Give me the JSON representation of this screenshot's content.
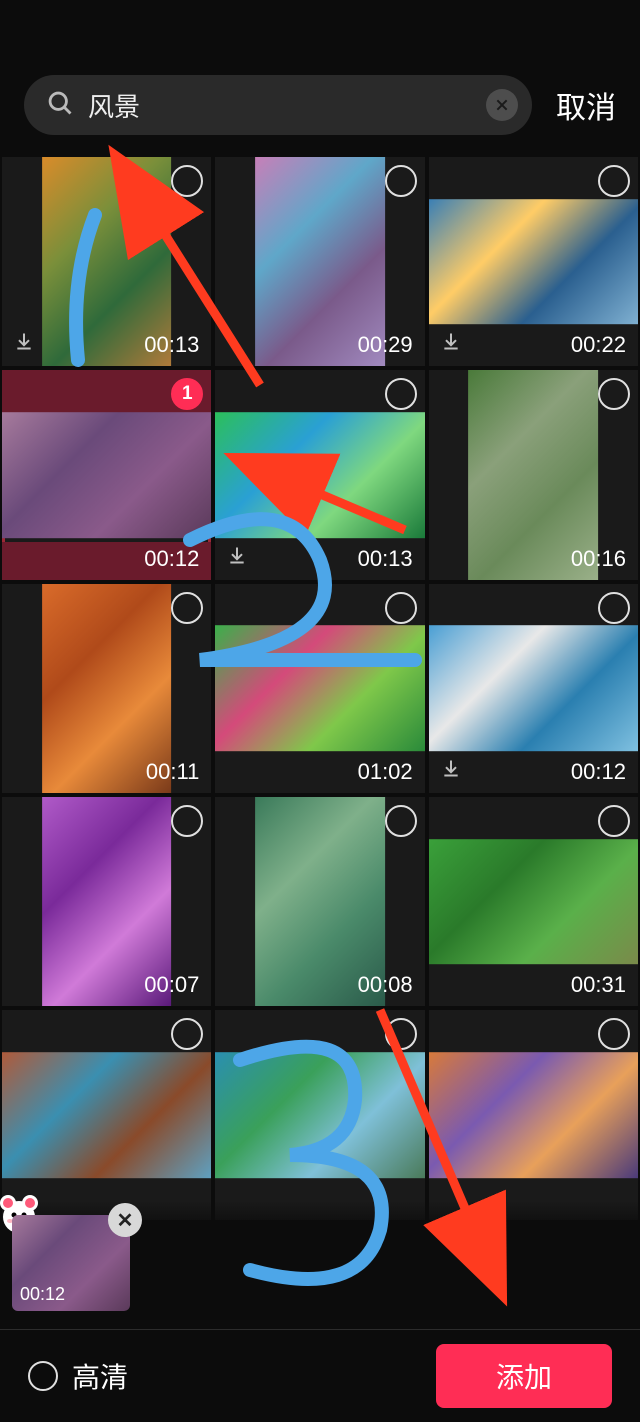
{
  "search": {
    "query": "风景",
    "cancel_label": "取消"
  },
  "grid": [
    {
      "duration": "00:13",
      "orient": "portrait",
      "scene": "autumn-park-path",
      "selected": false,
      "sel_badge": "",
      "show_dl": true,
      "colors": [
        "#d98b2a",
        "#7a8f3a",
        "#2f6a3a",
        "#b07a3a"
      ]
    },
    {
      "duration": "00:29",
      "orient": "portrait",
      "scene": "cherry-blossom-dock",
      "selected": false,
      "sel_badge": "",
      "show_dl": false,
      "colors": [
        "#c77fb8",
        "#5fa7c9",
        "#7a5a8a",
        "#a18abf"
      ]
    },
    {
      "duration": "00:22",
      "orient": "land",
      "scene": "sunset-sea-birds",
      "selected": false,
      "sel_badge": "",
      "show_dl": true,
      "colors": [
        "#3a7fb5",
        "#ffcc66",
        "#2a5f8f",
        "#7fb0d1"
      ]
    },
    {
      "duration": "00:12",
      "orient": "land",
      "scene": "girl-back-sea",
      "selected": true,
      "sel_badge": "1",
      "show_dl": false,
      "colors": [
        "#a67a9c",
        "#6a4a7a",
        "#8a5a8a",
        "#5a3a5a"
      ]
    },
    {
      "duration": "00:13",
      "orient": "land",
      "scene": "green-field-sky",
      "selected": false,
      "sel_badge": "",
      "show_dl": true,
      "colors": [
        "#2bbf5b",
        "#2aa0d4",
        "#7fd87f",
        "#1a7a3a"
      ]
    },
    {
      "duration": "00:16",
      "orient": "portrait",
      "scene": "boardwalk-trees",
      "selected": false,
      "sel_badge": "",
      "show_dl": false,
      "colors": [
        "#4a7a3a",
        "#8aa07a",
        "#6a8a5a",
        "#9ab089"
      ]
    },
    {
      "duration": "00:11",
      "orient": "portrait",
      "scene": "autumn-boardwalk",
      "selected": false,
      "sel_badge": "",
      "show_dl": false,
      "colors": [
        "#d96b2a",
        "#b04a1a",
        "#e88a3a",
        "#7a3a1a"
      ]
    },
    {
      "duration": "01:02",
      "orient": "land",
      "scene": "flower-meadow",
      "selected": false,
      "sel_badge": "",
      "show_dl": false,
      "colors": [
        "#3ab04a",
        "#d44a7a",
        "#7fc84a",
        "#2a8a3a"
      ]
    },
    {
      "duration": "00:12",
      "orient": "land",
      "scene": "bride-seaside",
      "selected": false,
      "sel_badge": "",
      "show_dl": true,
      "colors": [
        "#4a9fd4",
        "#e8e8e8",
        "#2a7fb0",
        "#7fc0e0"
      ]
    },
    {
      "duration": "00:07",
      "orient": "portrait",
      "scene": "purple-lavender-trees",
      "selected": false,
      "sel_badge": "",
      "show_dl": false,
      "colors": [
        "#b05ac8",
        "#7a2a9a",
        "#d07ad8",
        "#5a1a7a"
      ]
    },
    {
      "duration": "00:08",
      "orient": "portrait",
      "scene": "mountain-lake-lotus",
      "selected": false,
      "sel_badge": "",
      "show_dl": false,
      "colors": [
        "#3a7a5a",
        "#7fb08a",
        "#4a8a6a",
        "#2a5a4a"
      ]
    },
    {
      "duration": "00:31",
      "orient": "land",
      "scene": "rice-terrace-village",
      "selected": false,
      "sel_badge": "",
      "show_dl": false,
      "colors": [
        "#3aa03a",
        "#2a7a2a",
        "#5ab04a",
        "#7a8a4a"
      ]
    },
    {
      "duration": "",
      "orient": "land",
      "scene": "red-rock-canyon",
      "selected": false,
      "sel_badge": "",
      "show_dl": false,
      "colors": [
        "#b05a3a",
        "#3a8fb0",
        "#8a4a2a",
        "#5fa0c0"
      ]
    },
    {
      "duration": "",
      "orient": "land",
      "scene": "tropical-beach-palms",
      "selected": false,
      "sel_badge": "",
      "show_dl": false,
      "colors": [
        "#2a8fb0",
        "#3aa05a",
        "#7fc0d8",
        "#4a7a5a"
      ]
    },
    {
      "duration": "",
      "orient": "land",
      "scene": "sunset-path-clouds",
      "selected": false,
      "sel_badge": "",
      "show_dl": false,
      "colors": [
        "#d87a3a",
        "#7a5ab0",
        "#e8a05a",
        "#4a3a7a"
      ]
    }
  ],
  "tray": [
    {
      "duration": "00:12",
      "scene": "girl-back-sea",
      "colors": [
        "#a67a9c",
        "#6a4a7a",
        "#8a5a8a",
        "#5a3a5a"
      ]
    }
  ],
  "bottom": {
    "hd_label": "高清",
    "add_label": "添加"
  },
  "annotations": {
    "numbers": [
      "1",
      "2",
      "3"
    ],
    "color_arrow": "#ff3b1f",
    "color_number": "#4da6e8"
  }
}
